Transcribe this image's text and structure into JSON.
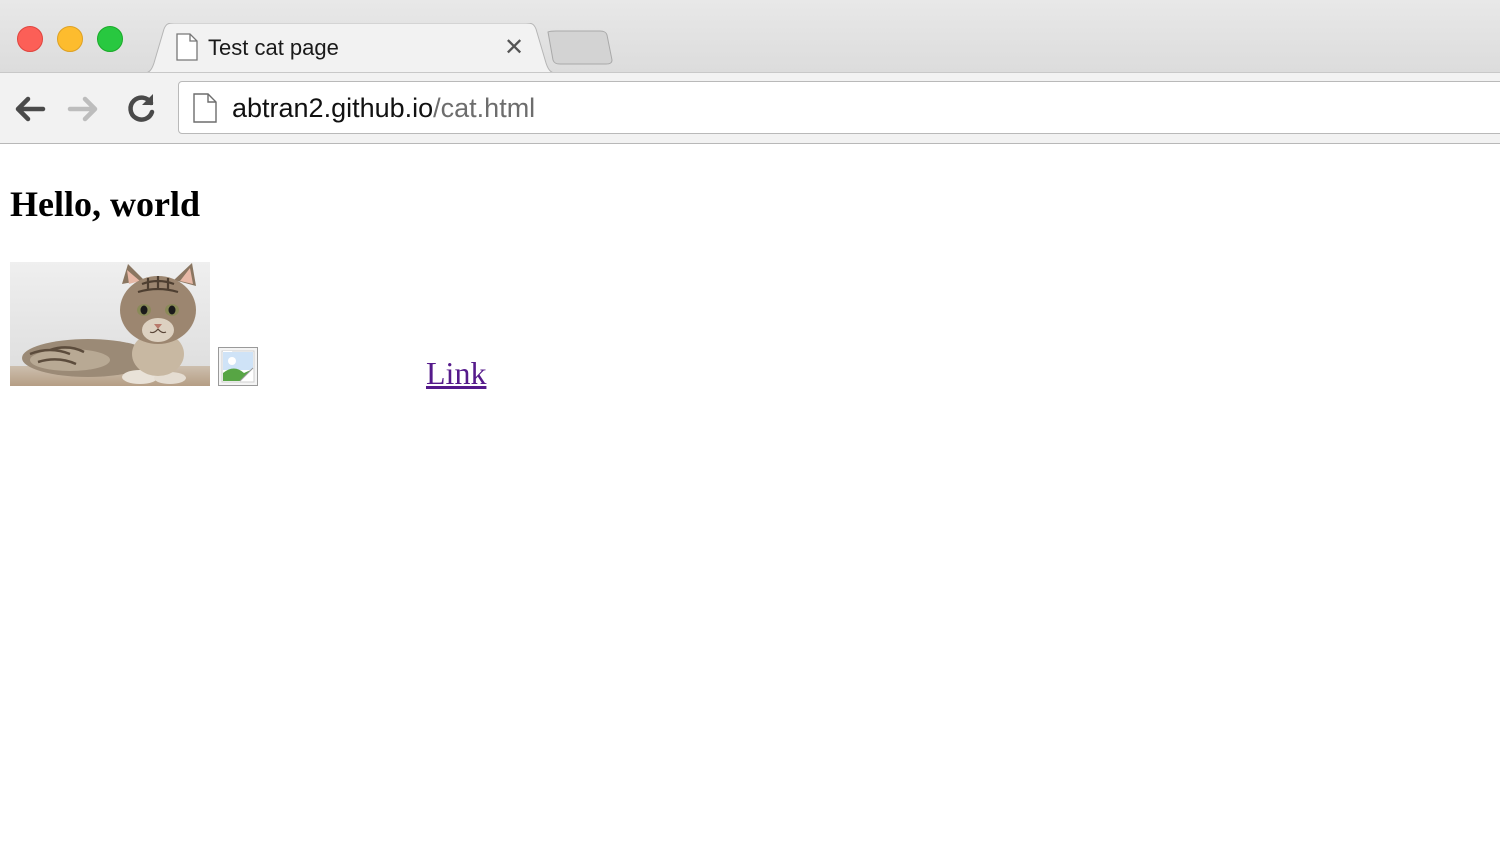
{
  "browser": {
    "tab": {
      "title": "Test cat page",
      "close_glyph": "✕",
      "icon": "page-icon"
    },
    "new_tab_icon": "new-tab-icon",
    "nav": {
      "back_icon": "back-arrow-icon",
      "forward_icon": "forward-arrow-icon",
      "reload_icon": "reload-icon"
    },
    "address_bar": {
      "host": "abtran2.github.io",
      "path": "/cat.html"
    },
    "window_controls": {
      "close_color": "#fc5f57",
      "minimize_color": "#fdbc2e",
      "maximize_color": "#28c840"
    }
  },
  "page": {
    "heading": "Hello, world",
    "images": [
      {
        "name": "cat-photo",
        "status": "loaded"
      },
      {
        "name": "broken-image",
        "status": "failed"
      }
    ],
    "link": {
      "label": "Link",
      "color": "#551a8b"
    }
  }
}
